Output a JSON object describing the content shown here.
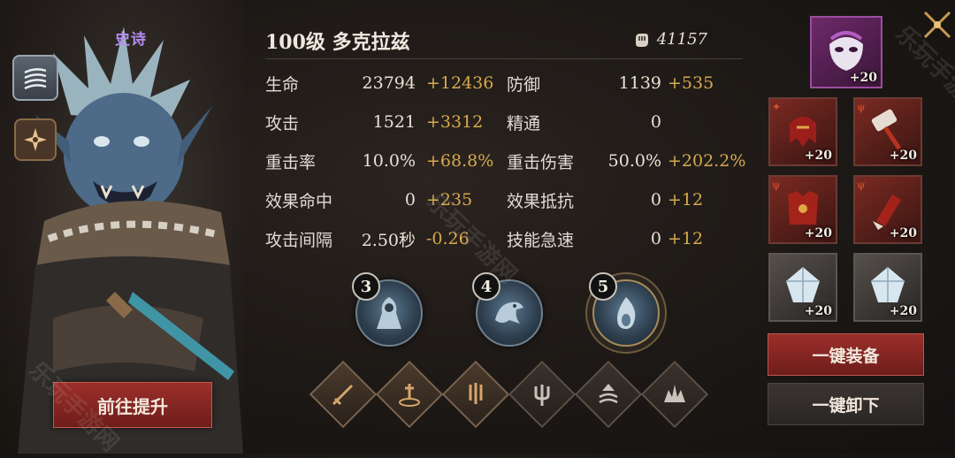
{
  "hero": {
    "rarity": "史诗",
    "title": "100级  多克拉兹",
    "power": "41157",
    "promote_label": "前往提升"
  },
  "stats": [
    {
      "label": "生命",
      "base": "23794",
      "bonus": "+12436"
    },
    {
      "label": "攻击",
      "base": "1521",
      "bonus": "+3312"
    },
    {
      "label": "重击率",
      "base": "10.0%",
      "bonus": "+68.8%"
    },
    {
      "label": "效果命中",
      "base": "0",
      "bonus": "+235"
    },
    {
      "label": "攻击间隔",
      "base": "2.50秒",
      "bonus": "-0.26"
    },
    {
      "label": "防御",
      "base": "1139",
      "bonus": "+535"
    },
    {
      "label": "精通",
      "base": "0",
      "bonus": ""
    },
    {
      "label": "重击伤害",
      "base": "50.0%",
      "bonus": "+202.2%"
    },
    {
      "label": "效果抵抗",
      "base": "0",
      "bonus": "+12"
    },
    {
      "label": "技能急速",
      "base": "0",
      "bonus": "+12"
    }
  ],
  "skills": [
    {
      "num": "3",
      "icon": "hooded-figure-icon"
    },
    {
      "num": "4",
      "icon": "dragon-head-icon"
    },
    {
      "num": "5",
      "icon": "flame-orb-icon"
    }
  ],
  "runes": [
    "sword-icon",
    "pedestal-sword-icon",
    "triple-blade-icon",
    "trident-icon",
    "rising-wave-icon",
    "crown-spikes-icon"
  ],
  "equipment": {
    "accessory_level": "+20",
    "items": [
      {
        "name": "helmet",
        "level": "+20"
      },
      {
        "name": "hammer",
        "level": "+20"
      },
      {
        "name": "armor",
        "level": "+20"
      },
      {
        "name": "gauntlet",
        "level": "+20"
      },
      {
        "name": "crystal",
        "level": "+20"
      },
      {
        "name": "crystal",
        "level": "+20"
      }
    ],
    "equip_all_label": "一键装备",
    "unequip_all_label": "一键卸下"
  },
  "watermark": "乐玩手游网",
  "colors": {
    "bonus": "#d7a94f",
    "rarity": "#b48cf0",
    "primary_button": "#9c2f2a"
  }
}
